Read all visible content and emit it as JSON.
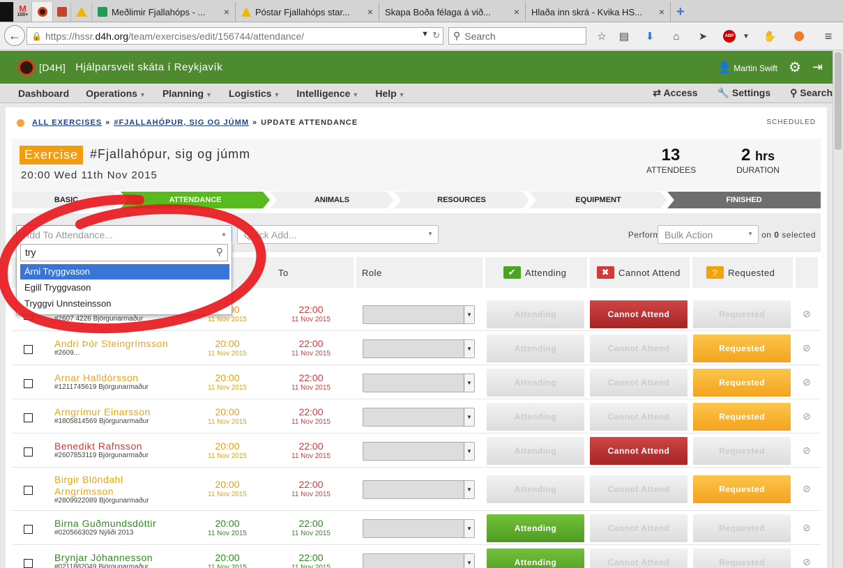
{
  "browser": {
    "tabs": [
      {
        "label": "Meðlimir Fjallahóps - ...",
        "icon": "sheets-icon",
        "color": "#1f9d55"
      },
      {
        "label": "Póstar Fjallahóps star...",
        "icon": "drive-icon",
        "color": "#f4b400"
      },
      {
        "label": "Skapa Boða félaga á við...",
        "icon": "",
        "color": ""
      },
      {
        "label": "Hlaða inn skrá - Kvika HS...",
        "icon": "",
        "color": ""
      }
    ],
    "pinned_badge": "100+",
    "url_prefix": "https://hssr.",
    "url_host": "d4h.org",
    "url_path": "/team/exercises/edit/156744/attendance/",
    "search_placeholder": "Search"
  },
  "header": {
    "brand": "[D4H]",
    "org": "Hjálparsveit skáta í Reykjavík",
    "user": "Martin Swift"
  },
  "menu": {
    "items": [
      "Dashboard",
      "Operations",
      "Planning",
      "Logistics",
      "Intelligence",
      "Help"
    ],
    "right": [
      "Access",
      "Settings",
      "Search"
    ]
  },
  "breadcrumb": {
    "all": "ALL EXERCISES",
    "sep": "»",
    "exercise": "#FJALLAHÓPUR, SIG OG JÚMM",
    "current": "UPDATE ATTENDANCE",
    "status": "SCHEDULED"
  },
  "exercise": {
    "badge": "Exercise",
    "title": "#Fjallahópur, sig og júmm",
    "date": "20:00 Wed 11th Nov 2015",
    "attendees": "13",
    "attendees_label": "ATTENDEES",
    "duration": "2",
    "duration_unit": "hrs",
    "duration_label": "DURATION"
  },
  "steps": [
    "BASIC",
    "ATTENDANCE",
    "ANIMALS",
    "RESOURCES",
    "EQUIPMENT",
    "FINISHED"
  ],
  "toolbar": {
    "add_placeholder": "Add To Attendance...",
    "quick_add": "Quick Add...",
    "perform": "Perform",
    "bulk": "Bulk Action",
    "on": "on",
    "selected_count": "0",
    "selected": "selected"
  },
  "table_headers": {
    "to": "To",
    "role": "Role",
    "attending": "Attending",
    "cannot": "Cannot Attend",
    "requested": "Requested"
  },
  "dropdown": {
    "query": "try",
    "options": [
      "Árni Tryggvason",
      "Egill Tryggvason",
      "Tryggvi Unnsteinsson"
    ]
  },
  "buttons": {
    "attending": "Attending",
    "cannot": "Cannot Attend",
    "requested": "Requested"
  },
  "colors": {
    "attending": "#2e8b20",
    "cannot": "#d33a3a",
    "requested": "#f0a30a",
    "header": "#4e8b2e"
  },
  "rows": [
    {
      "name": "",
      "member": "#2607 4226 Björgunarmaður",
      "from": "20:00",
      "to": "22:00",
      "date": "11 Nov 2015",
      "state": "cannot",
      "color": "#f0a30a"
    },
    {
      "name": "Andri Þór Steingrímsson",
      "member": "#2609...",
      "from": "20:00",
      "to": "22:00",
      "date": "11 Nov 2015",
      "state": "requested",
      "color": "#f0a30a"
    },
    {
      "name": "Arnar Halldórsson",
      "member": "#1211745619 Björgunarmaður",
      "from": "20:00",
      "to": "22:00",
      "date": "11 Nov 2015",
      "state": "requested",
      "color": "#f0a30a"
    },
    {
      "name": "Arngrímur Einarsson",
      "member": "#1805814569 Björgunarmaður",
      "from": "20:00",
      "to": "22:00",
      "date": "11 Nov 2015",
      "state": "requested",
      "color": "#f0a30a"
    },
    {
      "name": "Benedikt Rafnsson",
      "member": "#2607853119 Björgunarmaður",
      "from": "20:00",
      "to": "22:00",
      "date": "11 Nov 2015",
      "state": "cannot",
      "color": "#d33a3a"
    },
    {
      "name": "Birgir Blöndahl Arngrímsson",
      "member": "#2809922089 Björgunarmaður",
      "from": "20:00",
      "to": "22:00",
      "date": "11 Nov 2015",
      "state": "requested",
      "color": "#f0a30a"
    },
    {
      "name": "Birna Guðmundsdóttir",
      "member": "#0205663029 Nýliði 2013",
      "from": "20:00",
      "to": "22:00",
      "date": "11 Nov 2015",
      "state": "attending",
      "color": "#2e8b20"
    },
    {
      "name": "Brynjar Jóhannesson",
      "member": "#0211882049 Björgunarmaður",
      "from": "20:00",
      "to": "22:00",
      "date": "11 Nov 2015",
      "state": "attending",
      "color": "#2e8b20"
    }
  ]
}
